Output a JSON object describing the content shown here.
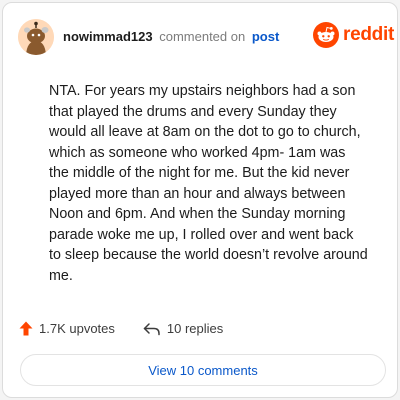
{
  "comment": {
    "username": "nowimmad123",
    "action_text": "commented on",
    "post_link": "post",
    "body": "NTA. For years my upstairs neighbors had a son that played the drums and every Sunday they would all leave at 8am on the dot to go to church, which as someone who worked 4pm- 1am was the middle of the night for me. But the kid never played more than an hour and always between Noon and 6pm. And when the Sunday morning parade woke me up, I rolled over and went back to sleep because the world doesn’t revolve around me."
  },
  "brand": {
    "name": "reddit",
    "color": "#ff4500",
    "icon": "reddit-logo-icon"
  },
  "stats": {
    "upvotes_label": "1.7K upvotes",
    "upvote_icon": "upvote-arrow-icon",
    "upvote_color": "#ff4500",
    "replies_label": "10 replies",
    "reply_icon": "reply-arrow-icon"
  },
  "footer": {
    "view_comments_label": "View 10 comments"
  }
}
